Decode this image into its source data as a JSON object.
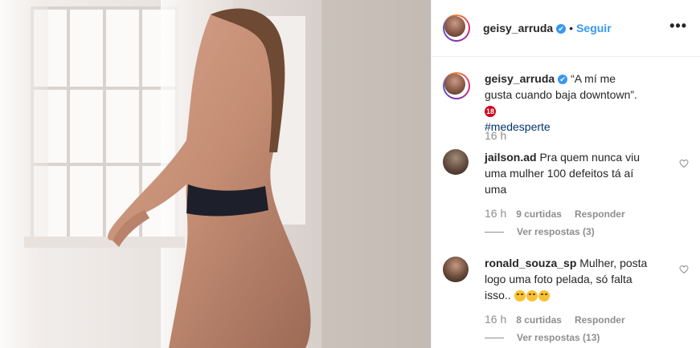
{
  "post": {
    "author": "geisy_arruda",
    "verified_symbol": "✔",
    "separator": "•",
    "follow_label": "Seguir",
    "more_label": "•••"
  },
  "caption": {
    "username": "geisy_arruda",
    "text": "“A mí me gusta cuando baja downtown”.",
    "age_badge": "18",
    "hashtag": "#medesperte",
    "time": "16 h"
  },
  "comments": [
    {
      "username": "jailson.ad",
      "text": "Pra quem nunca viu uma mulher 100 defeitos tá aí uma",
      "time": "16 h",
      "likes": "9 curtidas",
      "reply_label": "Responder",
      "view_replies": "Ver respostas (3)"
    },
    {
      "username": "ronald_souza_sp",
      "text": "Mulher, posta logo uma foto pelada, só falta isso..",
      "emoji_count": 3,
      "time": "16 h",
      "likes": "8 curtidas",
      "reply_label": "Responder",
      "view_replies": "Ver respostas (13)"
    }
  ],
  "colors": {
    "link_blue": "#3897f0",
    "hashtag_blue": "#003569",
    "meta_gray": "#8e8e8e",
    "verified_blue": "#3897f0"
  },
  "icons": [
    "more-options-icon",
    "verified-icon",
    "heart-icon",
    "laughing-emoji-icon",
    "age-18-icon"
  ]
}
